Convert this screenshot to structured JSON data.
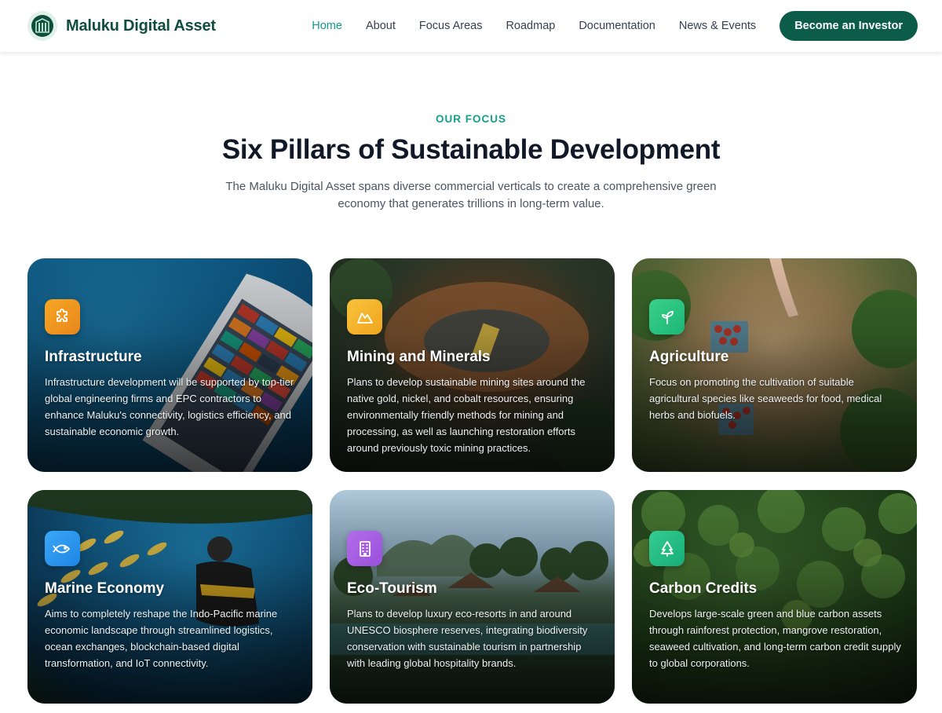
{
  "header": {
    "logo_text": "Maluku Digital Asset",
    "nav": [
      {
        "label": "Home",
        "active": true
      },
      {
        "label": "About",
        "active": false
      },
      {
        "label": "Focus Areas",
        "active": false
      },
      {
        "label": "Roadmap",
        "active": false
      },
      {
        "label": "Documentation",
        "active": false
      },
      {
        "label": "News & Events",
        "active": false
      }
    ],
    "cta_label": "Become an Investor"
  },
  "section": {
    "eyebrow": "OUR FOCUS",
    "title": "Six Pillars of Sustainable Development",
    "subtitle": "The Maluku Digital Asset spans diverse commercial verticals to create a comprehensive green economy that generates trillions in long-term value."
  },
  "cards": [
    {
      "title": "Infrastructure",
      "icon": "puzzle-icon",
      "description": "Infrastructure development will be supported by top-tier global engineering firms and EPC contractors to enhance Maluku's connectivity, logistics efficiency, and sustainable economic growth."
    },
    {
      "title": "Mining and Minerals",
      "icon": "mountain-icon",
      "description": "Plans to develop sustainable mining sites around the native gold, nickel, and cobalt resources, ensuring environmentally friendly methods for mining and processing, as well as launching restoration efforts around previously toxic mining practices."
    },
    {
      "title": "Agriculture",
      "icon": "sprout-icon",
      "description": "Focus on promoting the cultivation of suitable agricultural species like seaweeds for food, medical herbs and biofuels."
    },
    {
      "title": "Marine Economy",
      "icon": "fish-icon",
      "description": "Aims to completely reshape the Indo-Pacific marine economic landscape through streamlined logistics, ocean exchanges, blockchain-based digital transformation, and IoT connectivity."
    },
    {
      "title": "Eco-Tourism",
      "icon": "hotel-icon",
      "description": "Plans to develop luxury eco-resorts in and around UNESCO biosphere reserves, integrating biodiversity conservation with sustainable tourism in partnership with leading global hospitality brands."
    },
    {
      "title": "Carbon Credits",
      "icon": "tree-icon",
      "description": "Develops large-scale green and blue carbon assets through rainforest protection, mangrove restoration, seaweed cultivation, and long-term carbon credit supply to global corporations."
    }
  ],
  "colors": {
    "brand": "#0f4d3c",
    "accent": "#14a08c",
    "cta": "#0b5c49"
  }
}
